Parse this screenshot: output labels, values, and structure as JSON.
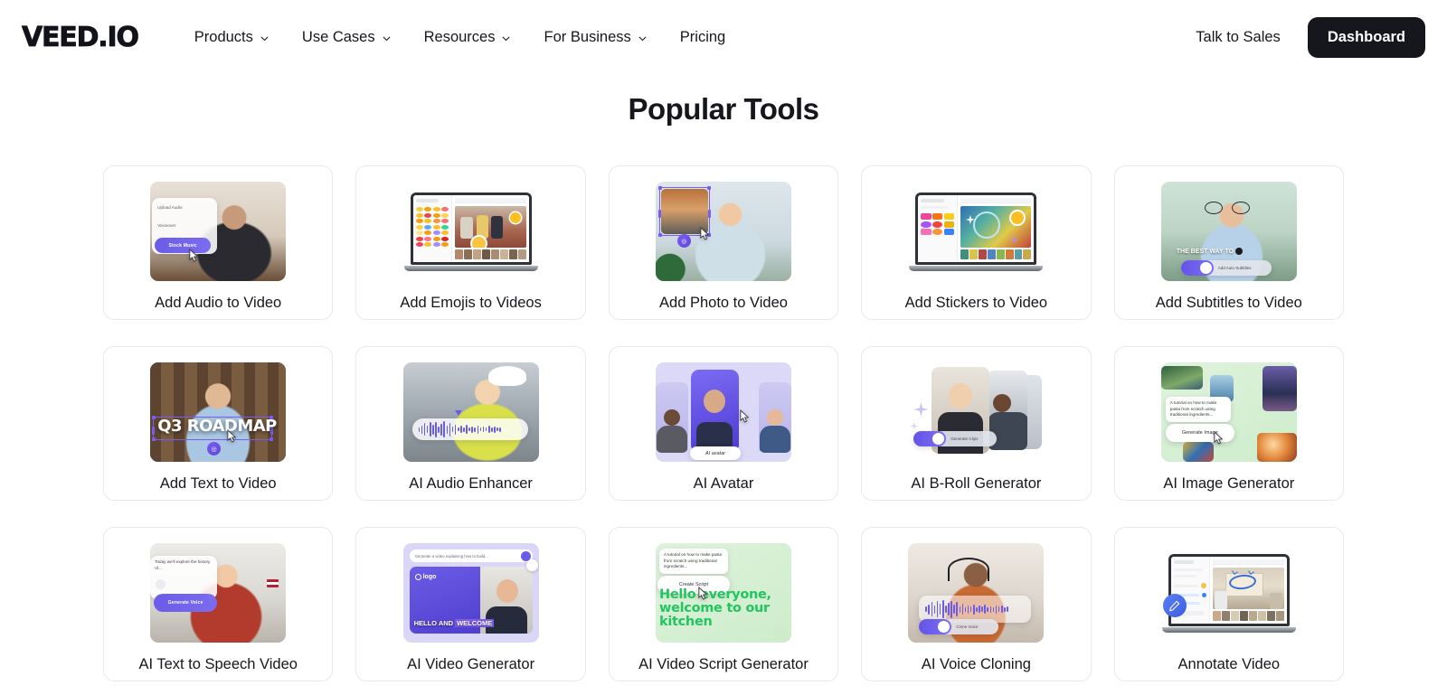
{
  "header": {
    "logo": "VEED.IO",
    "nav": [
      {
        "label": "Products",
        "has_chevron": true,
        "icon": "chevron-down-icon"
      },
      {
        "label": "Use Cases",
        "has_chevron": true,
        "icon": "chevron-down-icon"
      },
      {
        "label": "Resources",
        "has_chevron": true,
        "icon": "chevron-down-icon"
      },
      {
        "label": "For Business",
        "has_chevron": true,
        "icon": "chevron-down-icon"
      },
      {
        "label": "Pricing",
        "has_chevron": false,
        "icon": ""
      }
    ],
    "talk_to_sales": "Talk to Sales",
    "dashboard_button": "Dashboard"
  },
  "main": {
    "title": "Popular Tools",
    "cards": [
      {
        "label": "Add Audio to Video",
        "thumb": "woman-headphones-audio-panel",
        "overlay_texts": [
          "Upload Audio",
          "Voiceover",
          "Stock Music"
        ]
      },
      {
        "label": "Add Emojis to Videos",
        "thumb": "laptop-emoji-picker",
        "overlay_texts": []
      },
      {
        "label": "Add Photo to Video",
        "thumb": "man-photo-overlay-selection",
        "overlay_texts": []
      },
      {
        "label": "Add Stickers to Video",
        "thumb": "laptop-sticker-library",
        "overlay_texts": []
      },
      {
        "label": "Add Subtitles to Video",
        "thumb": "woman-glasses-subtitles",
        "overlay_texts": [
          "THE BEST WAY TO",
          "Add Auto Subtitles"
        ]
      },
      {
        "label": "Add Text to Video",
        "thumb": "man-bookshelf-title-text",
        "overlay_texts": [
          "Q3 ROADMAP"
        ]
      },
      {
        "label": "AI Audio Enhancer",
        "thumb": "worker-hardhat-waveform",
        "overlay_texts": []
      },
      {
        "label": "AI Avatar",
        "thumb": "three-avatar-portraits",
        "overlay_texts": [
          "AI avatar"
        ]
      },
      {
        "label": "AI B-Roll Generator",
        "thumb": "stacked-clips-toggle",
        "overlay_texts": [
          "Generate Clips"
        ]
      },
      {
        "label": "AI Image Generator",
        "thumb": "green-image-grid-prompt",
        "overlay_texts": [
          "A tutorial on how to make pasta from scratch using traditional ingredients...",
          "Generate Image"
        ]
      },
      {
        "label": "AI Text to Speech Video",
        "thumb": "man-red-shirt-voice-panel",
        "overlay_texts": [
          "Today we'll explore the history of...",
          "Generate Voice"
        ]
      },
      {
        "label": "AI Video Generator",
        "thumb": "purple-prompt-avatar-video",
        "overlay_texts": [
          "Generate a video explaining how to build...",
          "logo",
          "HELLO AND",
          "WELCOME"
        ]
      },
      {
        "label": "AI Video Script Generator",
        "thumb": "green-script-prompt",
        "overlay_texts": [
          "A tutorial on how to make pasta from scratch using traditional ingredients...",
          "Create Script",
          "Hello everyone, welcome to our kitchen"
        ]
      },
      {
        "label": "AI Voice Cloning",
        "thumb": "man-headset-waveform-toggle",
        "overlay_texts": [
          "Clone Voice"
        ]
      },
      {
        "label": "Annotate Video",
        "thumb": "laptop-annotation-pencil",
        "overlay_texts": []
      }
    ]
  },
  "colors": {
    "accent_purple": "#6b5ce7",
    "dark": "#16161d",
    "card_border": "#e9e9ec",
    "green_bg": "#d9f0d6",
    "lavender_bg": "#dcd9f8"
  }
}
